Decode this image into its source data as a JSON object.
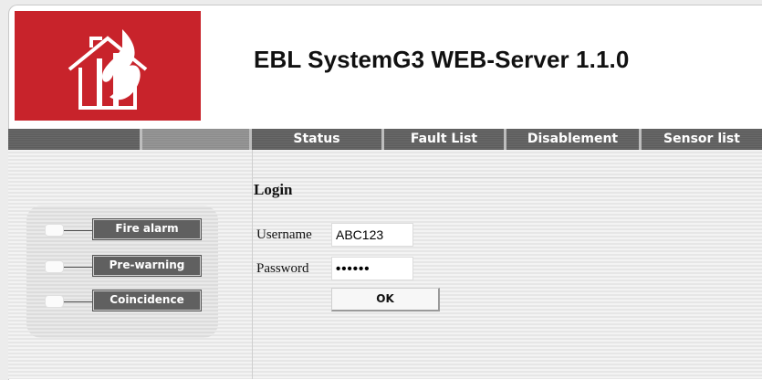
{
  "header": {
    "title": "EBL SystemG3 WEB-Server 1.1.0",
    "logo_icon": "fire-house-logo-icon"
  },
  "nav": {
    "tabs": [
      {
        "label": "Status"
      },
      {
        "label": "Fault List"
      },
      {
        "label": "Disablement"
      },
      {
        "label": "Sensor list"
      }
    ]
  },
  "login": {
    "title": "Login",
    "username_label": "Username",
    "username_value": "ABC123",
    "password_label": "Password",
    "password_value": "••••••",
    "ok_label": "OK"
  },
  "alarm_panel": {
    "items": [
      {
        "label": "Fire alarm"
      },
      {
        "label": "Pre-warning"
      },
      {
        "label": "Coincidence"
      }
    ]
  },
  "colors": {
    "brand_red": "#c8232b",
    "nav_gray": "#606060",
    "background": "#ececec"
  }
}
